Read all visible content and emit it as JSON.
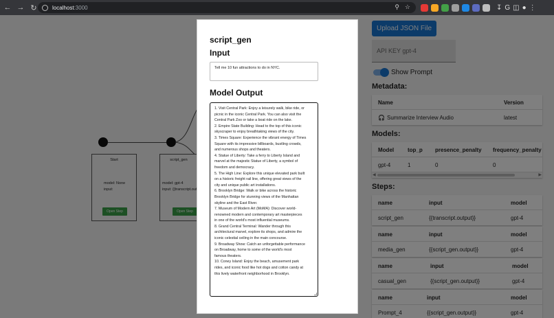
{
  "browser": {
    "url_host": "localhost",
    "url_port": ":3000"
  },
  "flow": {
    "nodes": [
      {
        "title": "Start",
        "line1": "model: None",
        "line2": "input:",
        "button": "Open Step"
      },
      {
        "title": "script_gen",
        "line1": "model: gpt-4",
        "line2": "input: {{transcript.output}}",
        "button": "Open Step"
      }
    ]
  },
  "panel": {
    "upload_label": "Upload JSON File",
    "api_key_placeholder": "API KEY gpt-4",
    "toggle_label": "Show Prompt",
    "metadata_heading": "Metadata:",
    "metadata": {
      "headers": [
        "Name",
        "Version"
      ],
      "rows": [
        {
          "name": "Summarize Interview Audio",
          "version": "latest"
        }
      ]
    },
    "models_heading": "Models:",
    "models": {
      "headers": [
        "Model",
        "top_p",
        "presence_penalty",
        "frequency_penalty"
      ],
      "rows": [
        {
          "model": "gpt-4",
          "top_p": "1",
          "presence": "0",
          "frequency": "0"
        }
      ]
    },
    "steps_heading": "Steps:",
    "steps": [
      {
        "headers": [
          "name",
          "input",
          "model"
        ],
        "name": "script_gen",
        "input": "{{transcript.output}}",
        "model": "gpt-4"
      },
      {
        "headers": [
          "name",
          "input",
          "model"
        ],
        "name": "media_gen",
        "input": "{{script_gen.output}}",
        "model": "gpt-4"
      },
      {
        "headers": [
          "name",
          "input",
          "model"
        ],
        "name": "casual_gen",
        "input": "{{script_gen.output}}",
        "model": "gpt-4"
      },
      {
        "headers": [
          "name",
          "input",
          "model"
        ],
        "name": "Prompt_4",
        "input": "{{script_gen.output}}",
        "model": "gpt-4"
      }
    ]
  },
  "modal": {
    "title": "script_gen",
    "input_heading": "Input",
    "input_value": "Tell me 10 fun attractions to do in NYC.",
    "output_heading": "Model Output",
    "output_lines": [
      "1. Visit Central Park: Enjoy a leisurely walk, bike ride, or",
      "picnic in the iconic Central Park. You can also visit the",
      "Central Park Zoo or take a boat ride on the lake.",
      "2. Empire State Building: Head to the top of this iconic",
      "skyscraper to enjoy breathtaking views of the city.",
      "3. Times Square: Experience the vibrant energy of Times",
      "Square with its impressive billboards, bustling crowds,",
      "and numerous shops and theaters.",
      "4. Statue of Liberty: Take a ferry to Liberty Island and",
      "marvel at the majestic Statue of Liberty, a symbol of",
      "freedom and democracy.",
      "5. The High Line: Explore this unique elevated park built",
      "on a historic freight rail line, offering great views of the",
      "city and unique public art installations.",
      "6. Brooklyn Bridge: Walk or bike across the historic",
      "Brooklyn Bridge for stunning views of the Manhattan",
      "skyline and the East River.",
      "7. Museum of Modern Art (MoMA): Discover world-",
      "renowned modern and contemporary art masterpieces",
      "in one of the world's most influential museums.",
      "8. Grand Central Terminal: Wander through this",
      "architectural marvel, explore its shops, and admire the",
      "iconic celestial ceiling in the main concourse.",
      "9. Broadway Show: Catch an unforgettable performance",
      "on Broadway, home to some of the world's most",
      "famous theaters.",
      "10. Coney Island: Enjoy the beach, amusement park",
      "rides, and iconic food like hot dogs and cotton candy at",
      "this lively waterfront neighborhood in Brooklyn."
    ]
  }
}
